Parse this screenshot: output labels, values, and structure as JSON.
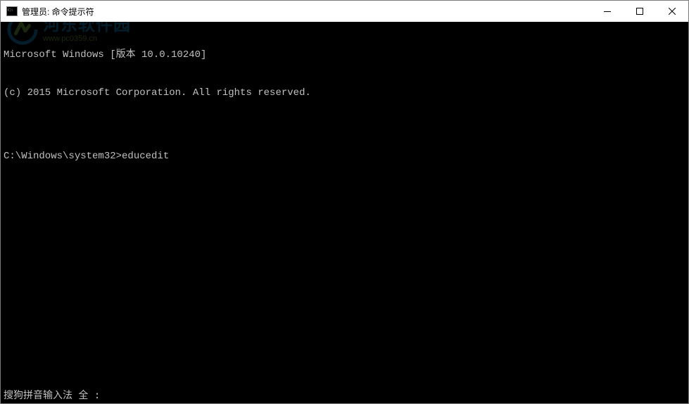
{
  "titlebar": {
    "icon_name": "cmd-icon",
    "title": "管理员: 命令提示符"
  },
  "window_controls": {
    "minimize_name": "minimize-icon",
    "maximize_name": "maximize-icon",
    "close_name": "close-icon"
  },
  "terminal": {
    "lines": [
      "Microsoft Windows [版本 10.0.10240]",
      "(c) 2015 Microsoft Corporation. All rights reserved.",
      ""
    ],
    "prompt": "C:\\Windows\\system32>",
    "input": "educedit"
  },
  "ime": {
    "status": "搜狗拼音输入法 全 :"
  },
  "watermark": {
    "site_name": "河东软件园",
    "url": "www.pc0359.cn"
  }
}
